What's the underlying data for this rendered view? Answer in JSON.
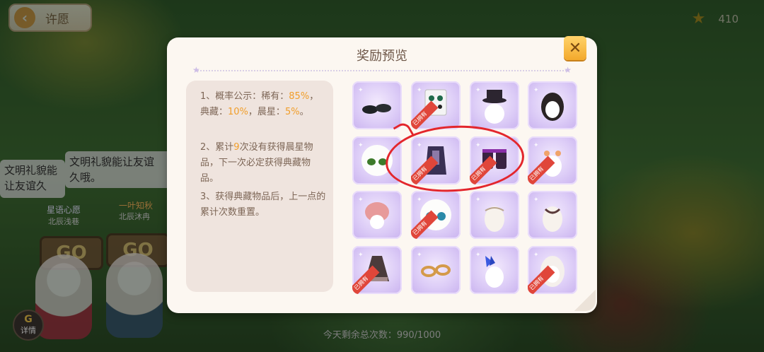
{
  "header": {
    "back_label": "许愿",
    "star_count": "410"
  },
  "chat": {
    "bubble_1": "文明礼貌能让友谊久哦。",
    "bubble_2_line1": "文明礼貌能让友谊",
    "bubble_2_line2": "久哦。"
  },
  "players": [
    {
      "title": "星语心愿",
      "name": "北辰浅巷"
    },
    {
      "title": "一叶知秋",
      "name": "北辰沐冉"
    }
  ],
  "go_label": "GO",
  "detail_label": "详情",
  "detail_icon": "G",
  "remaining": "今天剩余总次数：990/1000",
  "dialog": {
    "title": "奖励预览",
    "close_icon": "✕",
    "rules": [
      {
        "parts": [
          "1、概率公示：稀有：",
          "85%",
          "，典藏：",
          "10%",
          "，晨星：",
          "5%",
          "。"
        ]
      },
      {
        "parts": [
          "2、累计",
          "9",
          "次没有获得晨星物品，下一次必定获得典藏物品。"
        ]
      },
      {
        "parts": [
          "3、获得典藏物品后，上一点的累计次数重置。"
        ]
      }
    ],
    "owned_label": "已拥有",
    "items": [
      {
        "icon": "black-shoes-icon",
        "owned": false
      },
      {
        "icon": "green-earrings-icon",
        "owned": true
      },
      {
        "icon": "top-hat-icon",
        "owned": false
      },
      {
        "icon": "black-hair-icon",
        "owned": false
      },
      {
        "icon": "green-eyes-icon",
        "owned": false
      },
      {
        "icon": "dark-outfit-icon",
        "owned": true
      },
      {
        "icon": "purple-boots-icon",
        "owned": true
      },
      {
        "icon": "hair-bow-icon",
        "owned": true
      },
      {
        "icon": "pink-hair-icon",
        "owned": false
      },
      {
        "icon": "blue-eyes-icon",
        "owned": true
      },
      {
        "icon": "lace-top-icon",
        "owned": false
      },
      {
        "icon": "necklace-icon",
        "owned": false
      },
      {
        "icon": "dark-dress-icon",
        "owned": true
      },
      {
        "icon": "gold-rings-icon",
        "owned": false
      },
      {
        "icon": "butterfly-accessory-icon",
        "owned": false
      },
      {
        "icon": "white-hair-icon",
        "owned": true
      }
    ]
  },
  "colors": {
    "highlight": "#f19e2a",
    "annotation": "#e3262c",
    "owned_ribbon": "#e0463a"
  }
}
